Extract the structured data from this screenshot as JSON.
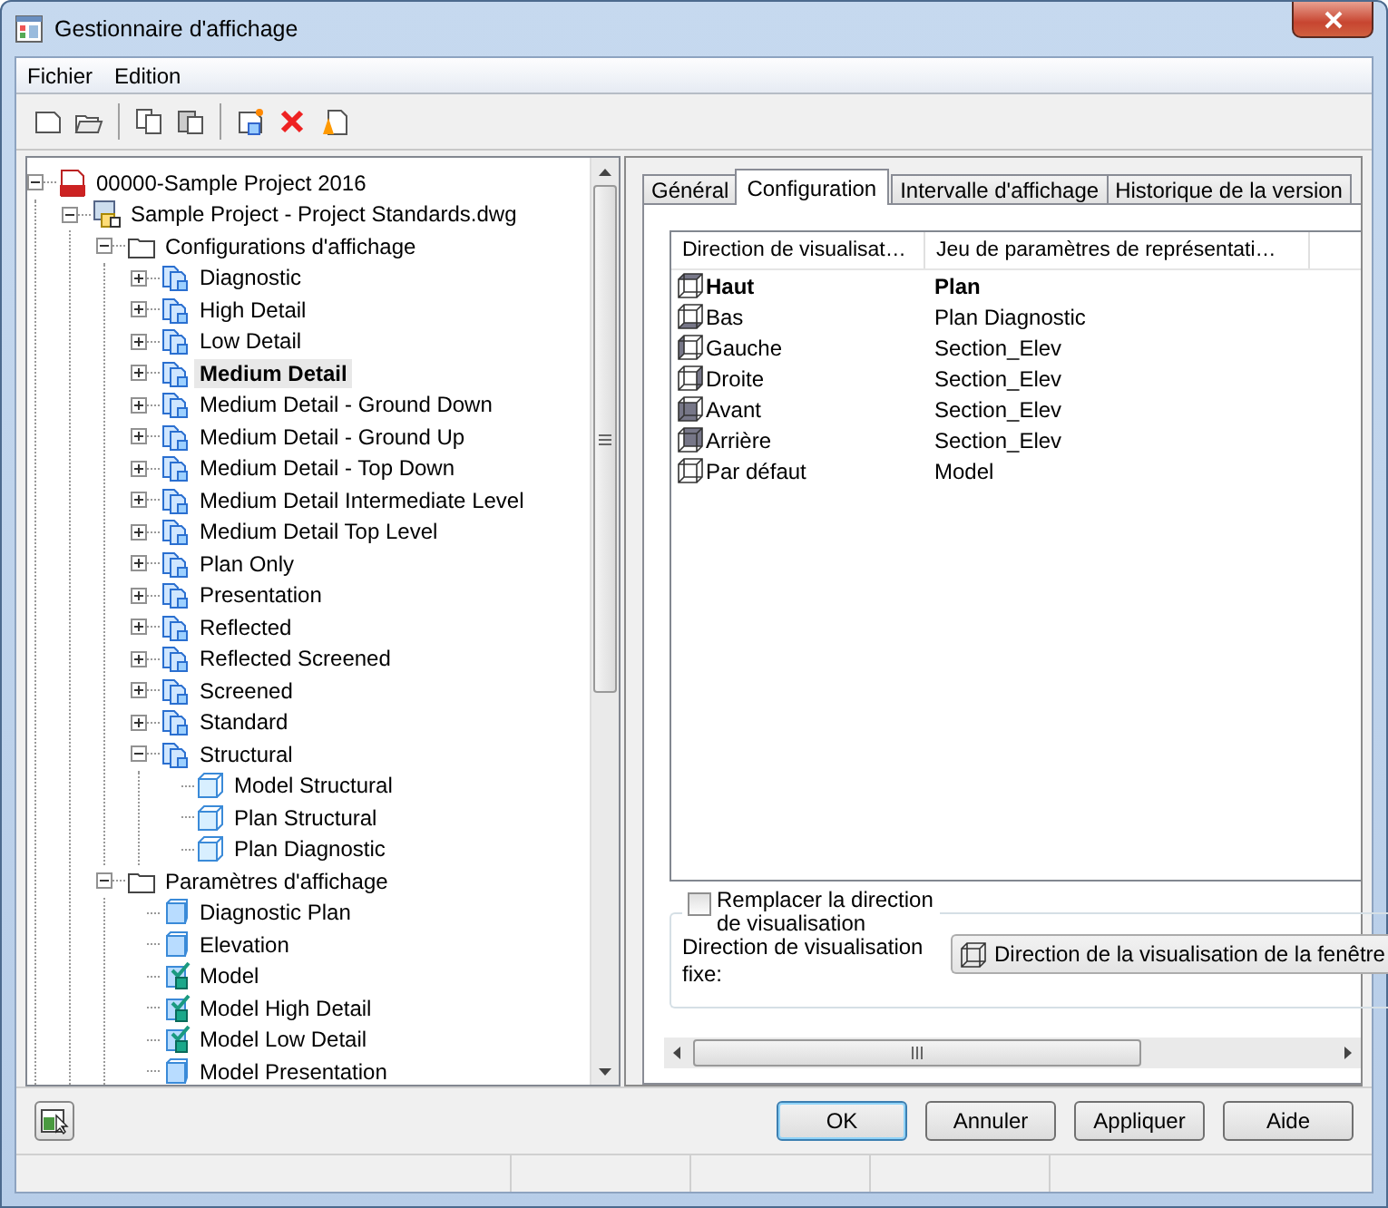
{
  "window": {
    "title": "Gestionnaire d'affichage"
  },
  "menu": [
    {
      "label": "Fichier"
    },
    {
      "label": "Edition"
    }
  ],
  "toolbar": [
    {
      "kind": "new"
    },
    {
      "kind": "open"
    },
    {
      "kind": "sep"
    },
    {
      "kind": "copy"
    },
    {
      "kind": "paste"
    },
    {
      "kind": "sep"
    },
    {
      "kind": "new-set"
    },
    {
      "kind": "delete"
    },
    {
      "kind": "purge"
    }
  ],
  "tree": {
    "items": [
      {
        "label": "00000-Sample Project 2016",
        "kind": "project",
        "expanded": true,
        "selected": false,
        "children": [
          {
            "label": "Sample Project - Project Standards.dwg",
            "kind": "drawing",
            "expanded": true,
            "selected": false,
            "children": [
              {
                "label": "Configurations d'affichage",
                "kind": "folder",
                "expanded": true,
                "selected": false,
                "children": [
                  {
                    "label": "Diagnostic",
                    "kind": "config",
                    "expanded": false,
                    "selected": false
                  },
                  {
                    "label": "High Detail",
                    "kind": "config",
                    "expanded": false,
                    "selected": false
                  },
                  {
                    "label": "Low Detail",
                    "kind": "config",
                    "expanded": false,
                    "selected": false
                  },
                  {
                    "label": "Medium Detail",
                    "kind": "config",
                    "expanded": false,
                    "selected": true
                  },
                  {
                    "label": "Medium Detail - Ground Down",
                    "kind": "config",
                    "expanded": false,
                    "selected": false
                  },
                  {
                    "label": "Medium Detail - Ground Up",
                    "kind": "config",
                    "expanded": false,
                    "selected": false
                  },
                  {
                    "label": "Medium Detail - Top Down",
                    "kind": "config",
                    "expanded": false,
                    "selected": false
                  },
                  {
                    "label": "Medium Detail Intermediate Level",
                    "kind": "config",
                    "expanded": false,
                    "selected": false
                  },
                  {
                    "label": "Medium Detail Top Level",
                    "kind": "config",
                    "expanded": false,
                    "selected": false
                  },
                  {
                    "label": "Plan Only",
                    "kind": "config",
                    "expanded": false,
                    "selected": false
                  },
                  {
                    "label": "Presentation",
                    "kind": "config",
                    "expanded": false,
                    "selected": false
                  },
                  {
                    "label": "Reflected",
                    "kind": "config",
                    "expanded": false,
                    "selected": false
                  },
                  {
                    "label": "Reflected Screened",
                    "kind": "config",
                    "expanded": false,
                    "selected": false
                  },
                  {
                    "label": "Screened",
                    "kind": "config",
                    "expanded": false,
                    "selected": false
                  },
                  {
                    "label": "Standard",
                    "kind": "config",
                    "expanded": false,
                    "selected": false
                  },
                  {
                    "label": "Structural",
                    "kind": "config",
                    "expanded": true,
                    "selected": false,
                    "children": [
                      {
                        "label": "Model Structural",
                        "kind": "rep",
                        "selected": false
                      },
                      {
                        "label": "Plan Structural",
                        "kind": "rep",
                        "selected": false
                      },
                      {
                        "label": "Plan Diagnostic",
                        "kind": "rep",
                        "selected": false
                      }
                    ]
                  }
                ]
              },
              {
                "label": "Paramètres d'affichage",
                "kind": "folder",
                "expanded": true,
                "selected": false,
                "children": [
                  {
                    "label": "Diagnostic Plan",
                    "kind": "set",
                    "selected": false
                  },
                  {
                    "label": "Elevation",
                    "kind": "set",
                    "selected": false
                  },
                  {
                    "label": "Model",
                    "kind": "set-check",
                    "selected": false
                  },
                  {
                    "label": "Model High Detail",
                    "kind": "set-check",
                    "selected": false
                  },
                  {
                    "label": "Model Low Detail",
                    "kind": "set-check",
                    "selected": false
                  },
                  {
                    "label": "Model Presentation",
                    "kind": "set",
                    "selected": false
                  }
                ]
              }
            ]
          }
        ]
      }
    ]
  },
  "tabs": [
    {
      "label": "Général",
      "selected": false
    },
    {
      "label": "Configuration",
      "selected": true
    },
    {
      "label": "Intervalle d'affichage",
      "selected": false
    },
    {
      "label": "Historique de la version",
      "selected": false
    }
  ],
  "table": {
    "columns": [
      "Direction de visualisat…",
      "Jeu de paramètres de représentati…"
    ],
    "rows": [
      {
        "direction": "Haut",
        "set": "Plan",
        "kind": "top",
        "selected": true
      },
      {
        "direction": "Bas",
        "set": "Plan Diagnostic",
        "kind": "bottom",
        "selected": false
      },
      {
        "direction": "Gauche",
        "set": "Section_Elev",
        "kind": "left",
        "selected": false
      },
      {
        "direction": "Droite",
        "set": "Section_Elev",
        "kind": "right",
        "selected": false
      },
      {
        "direction": "Avant",
        "set": "Section_Elev",
        "kind": "front",
        "selected": false
      },
      {
        "direction": "Arrière",
        "set": "Section_Elev",
        "kind": "back",
        "selected": false
      },
      {
        "direction": "Par défaut",
        "set": "Model",
        "kind": "default",
        "selected": false
      }
    ]
  },
  "override": {
    "label": "Remplacer la direction de visualisation",
    "checked": false
  },
  "fixed_direction": {
    "label": "Direction de visualisation fixe:",
    "value": "Direction de la visualisation de la fenêtre"
  },
  "buttons": [
    {
      "label": "OK",
      "default": true
    },
    {
      "label": "Annuler",
      "default": false
    },
    {
      "label": "Appliquer",
      "default": false
    },
    {
      "label": "Aide",
      "default": false
    }
  ]
}
